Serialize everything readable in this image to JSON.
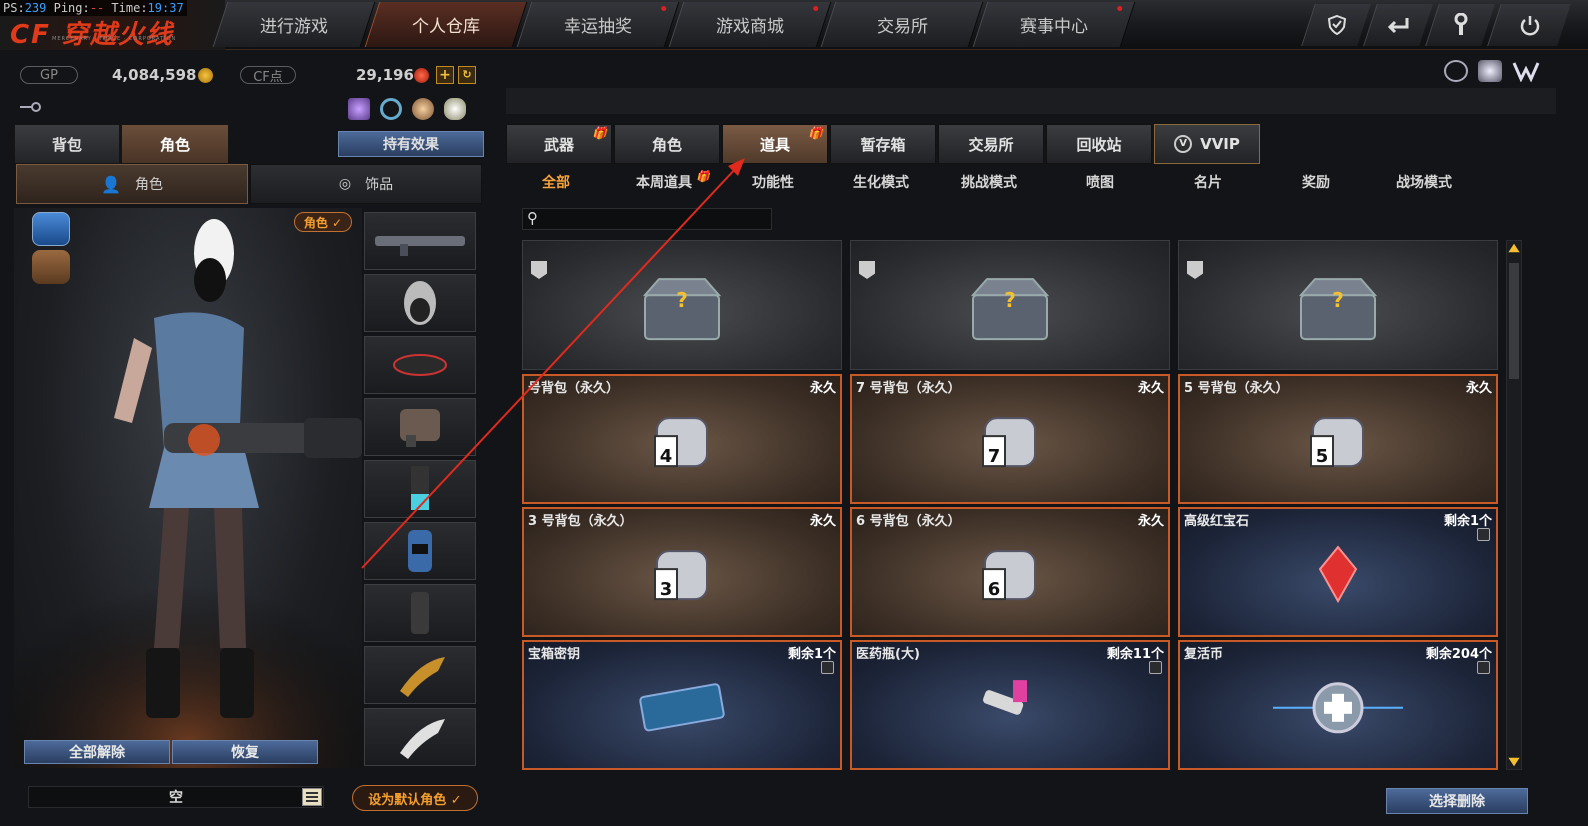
{
  "perf": {
    "ps_label": "PS:",
    "ps_value": "239",
    "ping_label": "Ping:",
    "ping_value": "--",
    "time_label": "Time:",
    "time_value": "19:37"
  },
  "nav": {
    "tabs": [
      {
        "label": "进行游戏",
        "dot": false
      },
      {
        "label": "个人仓库",
        "dot": false,
        "active": true
      },
      {
        "label": "幸运抽奖",
        "dot": true
      },
      {
        "label": "游戏商城",
        "dot": true
      },
      {
        "label": "交易所",
        "dot": false
      },
      {
        "label": "赛事中心",
        "dot": true
      }
    ],
    "system_icons": [
      "shield-icon",
      "back-icon",
      "wrench-icon",
      "power-icon"
    ]
  },
  "currency": {
    "gp_label": "GP",
    "gp_value": "4,084,598",
    "cf_label": "CF点",
    "cf_value": "29,196",
    "add_label": "+"
  },
  "left": {
    "tabs": [
      "背包",
      "角色"
    ],
    "active_tab": "角色",
    "effect_button": "持有效果",
    "subtabs": [
      "角色",
      "饰品"
    ],
    "role_badge": "角色 ✓",
    "buttons": {
      "unequip_all": "全部解除",
      "restore": "恢复"
    },
    "status_value": "空",
    "set_default": "设为默认角色 ✓"
  },
  "right": {
    "item_tabs": [
      {
        "label": "武器",
        "gift": true
      },
      {
        "label": "角色",
        "gift": false
      },
      {
        "label": "道具",
        "gift": true,
        "active": true
      },
      {
        "label": "暂存箱",
        "gift": false
      },
      {
        "label": "交易所",
        "gift": false
      },
      {
        "label": "回收站",
        "gift": false
      },
      {
        "label": "VVIP",
        "gift": false
      }
    ],
    "category_tabs": [
      {
        "label": "全部",
        "active": true
      },
      {
        "label": "本周道具",
        "gift": true
      },
      {
        "label": "功能性"
      },
      {
        "label": "生化模式"
      },
      {
        "label": "挑战模式"
      },
      {
        "label": "喷图"
      },
      {
        "label": "名片"
      },
      {
        "label": "奖励"
      },
      {
        "label": "战场模式"
      }
    ],
    "search_placeholder": "",
    "cards": [
      {
        "name": "",
        "status": "",
        "style": "box",
        "icon": "mystery-box-icon"
      },
      {
        "name": "",
        "status": "",
        "style": "box",
        "icon": "mystery-box-icon"
      },
      {
        "name": "",
        "status": "",
        "style": "box",
        "icon": "mystery-box-icon"
      },
      {
        "name": "号背包（永久）",
        "status": "永久",
        "style": "brown",
        "icon": "bag-icon",
        "bag_num": "4"
      },
      {
        "name": "7 号背包（永久）",
        "status": "永久",
        "style": "brown",
        "icon": "bag-icon",
        "bag_num": "7"
      },
      {
        "name": "5 号背包（永久）",
        "status": "永久",
        "style": "brown",
        "icon": "bag-icon",
        "bag_num": "5"
      },
      {
        "name": "3 号背包（永久）",
        "status": "永久",
        "style": "brown",
        "icon": "bag-icon",
        "bag_num": "3"
      },
      {
        "name": "6 号背包（永久）",
        "status": "永久",
        "style": "brown",
        "icon": "bag-icon",
        "bag_num": "6"
      },
      {
        "name": "高级红宝石",
        "status": "剩余1个",
        "style": "blue",
        "icon": "ruby-icon"
      },
      {
        "name": "宝箱密钥",
        "status": "剩余1个",
        "style": "blue",
        "icon": "keycard-icon"
      },
      {
        "name": "医药瓶(大)",
        "status": "剩余11个",
        "style": "blue",
        "icon": "medicine-gun-icon"
      },
      {
        "name": "复活币",
        "status": "剩余204个",
        "style": "blue",
        "icon": "revive-coin-icon"
      }
    ],
    "delete_button": "选择删除"
  },
  "colors": {
    "accent": "#c85a28",
    "active_text": "#f7a23a",
    "arrow": "#e02a1e"
  }
}
